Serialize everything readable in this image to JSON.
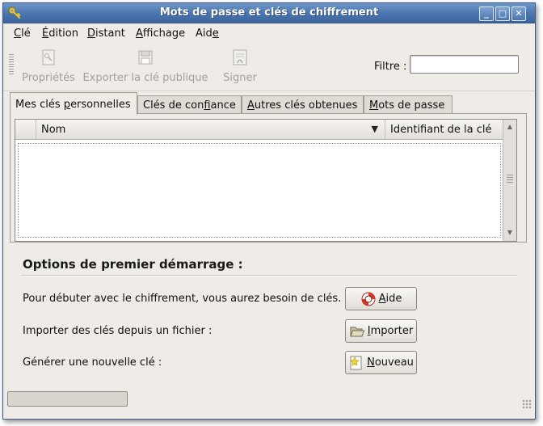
{
  "window": {
    "title": "Mots de passe et clés de chiffrement",
    "controls": {
      "minimize": "_",
      "maximize": "□",
      "close": "✕"
    }
  },
  "menu": [
    {
      "name": "cle",
      "pre": "",
      "mnemonic": "C",
      "post": "lé"
    },
    {
      "name": "edition",
      "pre": "",
      "mnemonic": "É",
      "post": "dition"
    },
    {
      "name": "distant",
      "pre": "",
      "mnemonic": "D",
      "post": "istant"
    },
    {
      "name": "affichage",
      "pre": "",
      "mnemonic": "A",
      "post": "ffichage"
    },
    {
      "name": "aide",
      "pre": "Aid",
      "mnemonic": "e",
      "post": ""
    }
  ],
  "toolbar": {
    "properties_label": "Propriétés",
    "export_label": "Exporter la clé publique",
    "sign_label": "Signer",
    "filter_label": "Filtre :",
    "filter_value": ""
  },
  "tabs": [
    {
      "pre": "Mes clés ",
      "mnemonic": "p",
      "post": "ersonnelles",
      "active": true
    },
    {
      "pre": "Clés de con",
      "mnemonic": "f",
      "post": "iance",
      "active": false
    },
    {
      "pre": "",
      "mnemonic": "A",
      "post": "utres clés obtenues",
      "active": false
    },
    {
      "pre": "",
      "mnemonic": "M",
      "post": "ots de passe",
      "active": false
    }
  ],
  "key_list": {
    "columns": {
      "name": "Nom",
      "id": "Identifiant de la clé"
    },
    "rows": []
  },
  "first_start": {
    "title": "Options de premier démarrage :",
    "items": [
      {
        "label": "Pour débuter avec le chiffrement, vous aurez besoin de clés.",
        "button_mnemonic": "A",
        "button_rest": "ide",
        "icon": "lifebuoy-icon"
      },
      {
        "label": "Importer des clés depuis un fichier :",
        "button_mnemonic": "I",
        "button_rest": "mporter",
        "icon": "folder-open-icon"
      },
      {
        "label": "Générer une nouvelle clé :",
        "button_mnemonic": "N",
        "button_rest": "ouveau",
        "icon": "new-key-icon"
      }
    ]
  },
  "status": {
    "progress": 0
  }
}
